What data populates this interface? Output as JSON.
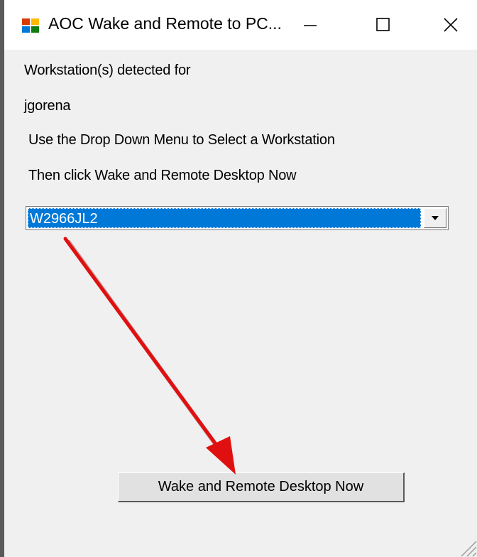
{
  "window": {
    "title": "AOC Wake and Remote to PC...",
    "controls": {
      "minimize_icon": "minimize-icon",
      "maximize_icon": "maximize-icon",
      "close_icon": "close-icon"
    }
  },
  "labels": {
    "detected": "Workstation(s) detected for",
    "username": "jgorena",
    "instruction1": "Use the Drop Down Menu to Select a Workstation",
    "instruction2": "Then click Wake and Remote Desktop Now"
  },
  "workstation_select": {
    "selected_value": "W2966JL2"
  },
  "action_button": {
    "label": "Wake and Remote Desktop Now"
  },
  "annotation": {
    "arrow_color": "#e01010"
  },
  "colors": {
    "selection": "#0078d7",
    "window_bg": "#f0f0f0"
  }
}
